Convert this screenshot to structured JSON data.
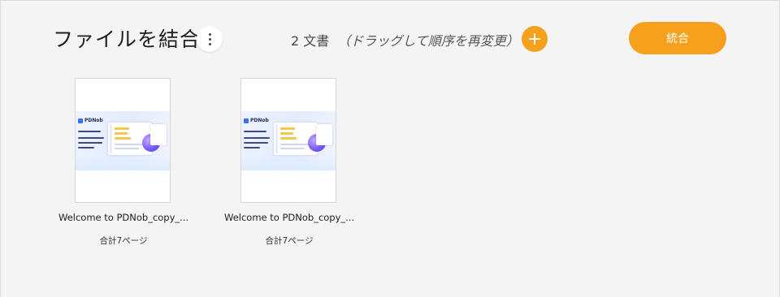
{
  "header": {
    "title": "ファイルを結合",
    "doc_count": "2 文書",
    "hint": "（ドラッグして順序を再変更）",
    "merge_label": "統合"
  },
  "colors": {
    "accent": "#f7a01e",
    "background": "#f4f4f4"
  },
  "icons": {
    "more": "more-vertical-icon",
    "add": "plus-icon"
  },
  "documents": [
    {
      "name": "Welcome to PDNob_copy_...",
      "pages": "合計7ページ",
      "preview_logo": "PDNob"
    },
    {
      "name": "Welcome to PDNob_copy_...",
      "pages": "合計7ページ",
      "preview_logo": "PDNob"
    }
  ]
}
